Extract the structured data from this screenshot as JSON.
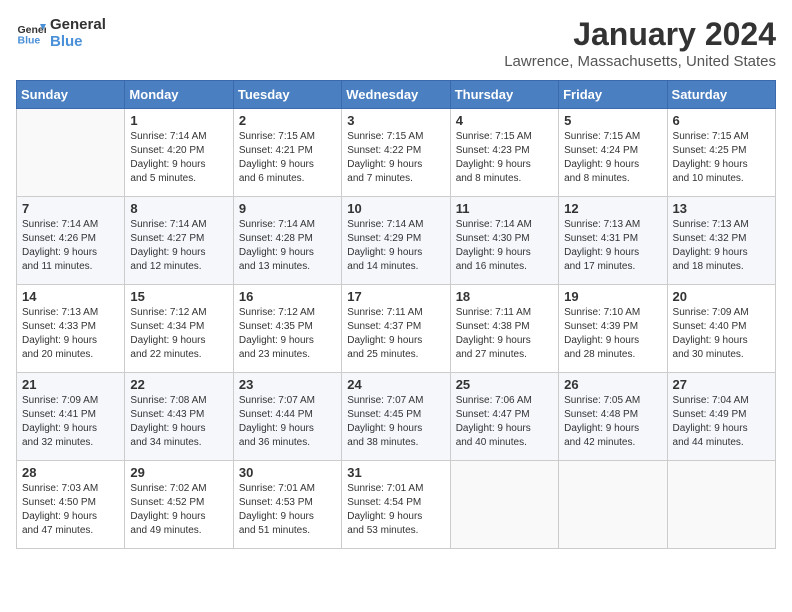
{
  "logo": {
    "line1": "General",
    "line2": "Blue"
  },
  "title": "January 2024",
  "location": "Lawrence, Massachusetts, United States",
  "days_header": [
    "Sunday",
    "Monday",
    "Tuesday",
    "Wednesday",
    "Thursday",
    "Friday",
    "Saturday"
  ],
  "weeks": [
    [
      {
        "day": "",
        "info": ""
      },
      {
        "day": "1",
        "info": "Sunrise: 7:14 AM\nSunset: 4:20 PM\nDaylight: 9 hours\nand 5 minutes."
      },
      {
        "day": "2",
        "info": "Sunrise: 7:15 AM\nSunset: 4:21 PM\nDaylight: 9 hours\nand 6 minutes."
      },
      {
        "day": "3",
        "info": "Sunrise: 7:15 AM\nSunset: 4:22 PM\nDaylight: 9 hours\nand 7 minutes."
      },
      {
        "day": "4",
        "info": "Sunrise: 7:15 AM\nSunset: 4:23 PM\nDaylight: 9 hours\nand 8 minutes."
      },
      {
        "day": "5",
        "info": "Sunrise: 7:15 AM\nSunset: 4:24 PM\nDaylight: 9 hours\nand 8 minutes."
      },
      {
        "day": "6",
        "info": "Sunrise: 7:15 AM\nSunset: 4:25 PM\nDaylight: 9 hours\nand 10 minutes."
      }
    ],
    [
      {
        "day": "7",
        "info": "Sunrise: 7:14 AM\nSunset: 4:26 PM\nDaylight: 9 hours\nand 11 minutes."
      },
      {
        "day": "8",
        "info": "Sunrise: 7:14 AM\nSunset: 4:27 PM\nDaylight: 9 hours\nand 12 minutes."
      },
      {
        "day": "9",
        "info": "Sunrise: 7:14 AM\nSunset: 4:28 PM\nDaylight: 9 hours\nand 13 minutes."
      },
      {
        "day": "10",
        "info": "Sunrise: 7:14 AM\nSunset: 4:29 PM\nDaylight: 9 hours\nand 14 minutes."
      },
      {
        "day": "11",
        "info": "Sunrise: 7:14 AM\nSunset: 4:30 PM\nDaylight: 9 hours\nand 16 minutes."
      },
      {
        "day": "12",
        "info": "Sunrise: 7:13 AM\nSunset: 4:31 PM\nDaylight: 9 hours\nand 17 minutes."
      },
      {
        "day": "13",
        "info": "Sunrise: 7:13 AM\nSunset: 4:32 PM\nDaylight: 9 hours\nand 18 minutes."
      }
    ],
    [
      {
        "day": "14",
        "info": "Sunrise: 7:13 AM\nSunset: 4:33 PM\nDaylight: 9 hours\nand 20 minutes."
      },
      {
        "day": "15",
        "info": "Sunrise: 7:12 AM\nSunset: 4:34 PM\nDaylight: 9 hours\nand 22 minutes."
      },
      {
        "day": "16",
        "info": "Sunrise: 7:12 AM\nSunset: 4:35 PM\nDaylight: 9 hours\nand 23 minutes."
      },
      {
        "day": "17",
        "info": "Sunrise: 7:11 AM\nSunset: 4:37 PM\nDaylight: 9 hours\nand 25 minutes."
      },
      {
        "day": "18",
        "info": "Sunrise: 7:11 AM\nSunset: 4:38 PM\nDaylight: 9 hours\nand 27 minutes."
      },
      {
        "day": "19",
        "info": "Sunrise: 7:10 AM\nSunset: 4:39 PM\nDaylight: 9 hours\nand 28 minutes."
      },
      {
        "day": "20",
        "info": "Sunrise: 7:09 AM\nSunset: 4:40 PM\nDaylight: 9 hours\nand 30 minutes."
      }
    ],
    [
      {
        "day": "21",
        "info": "Sunrise: 7:09 AM\nSunset: 4:41 PM\nDaylight: 9 hours\nand 32 minutes."
      },
      {
        "day": "22",
        "info": "Sunrise: 7:08 AM\nSunset: 4:43 PM\nDaylight: 9 hours\nand 34 minutes."
      },
      {
        "day": "23",
        "info": "Sunrise: 7:07 AM\nSunset: 4:44 PM\nDaylight: 9 hours\nand 36 minutes."
      },
      {
        "day": "24",
        "info": "Sunrise: 7:07 AM\nSunset: 4:45 PM\nDaylight: 9 hours\nand 38 minutes."
      },
      {
        "day": "25",
        "info": "Sunrise: 7:06 AM\nSunset: 4:47 PM\nDaylight: 9 hours\nand 40 minutes."
      },
      {
        "day": "26",
        "info": "Sunrise: 7:05 AM\nSunset: 4:48 PM\nDaylight: 9 hours\nand 42 minutes."
      },
      {
        "day": "27",
        "info": "Sunrise: 7:04 AM\nSunset: 4:49 PM\nDaylight: 9 hours\nand 44 minutes."
      }
    ],
    [
      {
        "day": "28",
        "info": "Sunrise: 7:03 AM\nSunset: 4:50 PM\nDaylight: 9 hours\nand 47 minutes."
      },
      {
        "day": "29",
        "info": "Sunrise: 7:02 AM\nSunset: 4:52 PM\nDaylight: 9 hours\nand 49 minutes."
      },
      {
        "day": "30",
        "info": "Sunrise: 7:01 AM\nSunset: 4:53 PM\nDaylight: 9 hours\nand 51 minutes."
      },
      {
        "day": "31",
        "info": "Sunrise: 7:01 AM\nSunset: 4:54 PM\nDaylight: 9 hours\nand 53 minutes."
      },
      {
        "day": "",
        "info": ""
      },
      {
        "day": "",
        "info": ""
      },
      {
        "day": "",
        "info": ""
      }
    ]
  ]
}
